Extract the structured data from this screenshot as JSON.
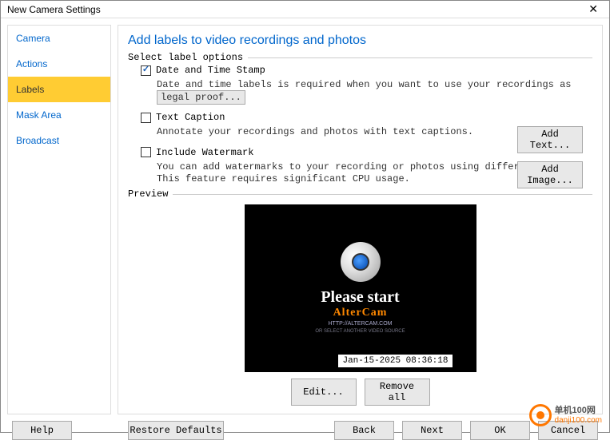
{
  "window": {
    "title": "New Camera Settings"
  },
  "sidebar": {
    "items": [
      {
        "label": "Camera"
      },
      {
        "label": "Actions"
      },
      {
        "label": "Labels"
      },
      {
        "label": "Mask Area"
      },
      {
        "label": "Broadcast"
      }
    ],
    "active_index": 2
  },
  "page": {
    "title": "Add labels to video recordings and photos",
    "fieldset_label": "Select label options",
    "options": {
      "date_time": {
        "checked": true,
        "label": "Date and Time Stamp",
        "desc": "Date and time labels is required when you want to use your recordings as",
        "link": "legal proof..."
      },
      "text_caption": {
        "checked": false,
        "label": "Text Caption",
        "desc": "Annotate your recordings and photos with text captions.",
        "button": "Add Text..."
      },
      "watermark": {
        "checked": false,
        "label": "Include Watermark",
        "desc": "You can add watermarks to your recording or photos using different images. This feature requires significant CPU usage.",
        "button": "Add Image..."
      }
    },
    "preview": {
      "legend": "Preview",
      "text_main": "Please start",
      "text_brand": "AlterCam",
      "text_url": "HTTP://ALTERCAM.COM",
      "text_sub": "OR SELECT ANOTHER VIDEO SOURCE",
      "timestamp": "Jan-15-2025 08:36:18",
      "edit_btn": "Edit...",
      "remove_btn": "Remove all"
    }
  },
  "buttons": {
    "help": "Help",
    "restore": "Restore Defaults",
    "back": "Back",
    "next": "Next",
    "ok": "OK",
    "cancel": "Cancel"
  },
  "watermark": {
    "top": "单机100网",
    "bottom": "danji100.com"
  }
}
